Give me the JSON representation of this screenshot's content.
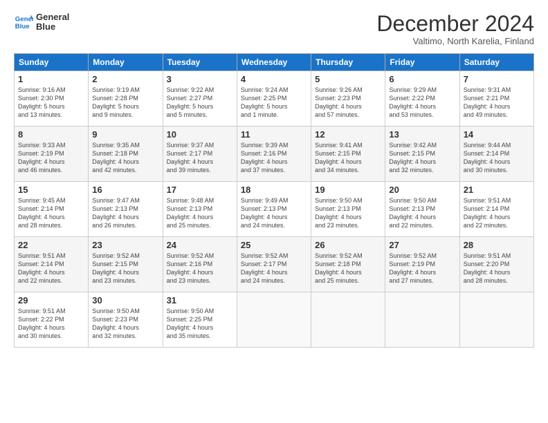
{
  "header": {
    "logo_line1": "General",
    "logo_line2": "Blue",
    "month_title": "December 2024",
    "location": "Valtimo, North Karelia, Finland"
  },
  "days_of_week": [
    "Sunday",
    "Monday",
    "Tuesday",
    "Wednesday",
    "Thursday",
    "Friday",
    "Saturday"
  ],
  "weeks": [
    [
      {
        "day": "1",
        "info": "Sunrise: 9:16 AM\nSunset: 2:30 PM\nDaylight: 5 hours\nand 13 minutes."
      },
      {
        "day": "2",
        "info": "Sunrise: 9:19 AM\nSunset: 2:28 PM\nDaylight: 5 hours\nand 9 minutes."
      },
      {
        "day": "3",
        "info": "Sunrise: 9:22 AM\nSunset: 2:27 PM\nDaylight: 5 hours\nand 5 minutes."
      },
      {
        "day": "4",
        "info": "Sunrise: 9:24 AM\nSunset: 2:25 PM\nDaylight: 5 hours\nand 1 minute."
      },
      {
        "day": "5",
        "info": "Sunrise: 9:26 AM\nSunset: 2:23 PM\nDaylight: 4 hours\nand 57 minutes."
      },
      {
        "day": "6",
        "info": "Sunrise: 9:29 AM\nSunset: 2:22 PM\nDaylight: 4 hours\nand 53 minutes."
      },
      {
        "day": "7",
        "info": "Sunrise: 9:31 AM\nSunset: 2:21 PM\nDaylight: 4 hours\nand 49 minutes."
      }
    ],
    [
      {
        "day": "8",
        "info": "Sunrise: 9:33 AM\nSunset: 2:19 PM\nDaylight: 4 hours\nand 46 minutes."
      },
      {
        "day": "9",
        "info": "Sunrise: 9:35 AM\nSunset: 2:18 PM\nDaylight: 4 hours\nand 42 minutes."
      },
      {
        "day": "10",
        "info": "Sunrise: 9:37 AM\nSunset: 2:17 PM\nDaylight: 4 hours\nand 39 minutes."
      },
      {
        "day": "11",
        "info": "Sunrise: 9:39 AM\nSunset: 2:16 PM\nDaylight: 4 hours\nand 37 minutes."
      },
      {
        "day": "12",
        "info": "Sunrise: 9:41 AM\nSunset: 2:15 PM\nDaylight: 4 hours\nand 34 minutes."
      },
      {
        "day": "13",
        "info": "Sunrise: 9:42 AM\nSunset: 2:15 PM\nDaylight: 4 hours\nand 32 minutes."
      },
      {
        "day": "14",
        "info": "Sunrise: 9:44 AM\nSunset: 2:14 PM\nDaylight: 4 hours\nand 30 minutes."
      }
    ],
    [
      {
        "day": "15",
        "info": "Sunrise: 9:45 AM\nSunset: 2:14 PM\nDaylight: 4 hours\nand 28 minutes."
      },
      {
        "day": "16",
        "info": "Sunrise: 9:47 AM\nSunset: 2:13 PM\nDaylight: 4 hours\nand 26 minutes."
      },
      {
        "day": "17",
        "info": "Sunrise: 9:48 AM\nSunset: 2:13 PM\nDaylight: 4 hours\nand 25 minutes."
      },
      {
        "day": "18",
        "info": "Sunrise: 9:49 AM\nSunset: 2:13 PM\nDaylight: 4 hours\nand 24 minutes."
      },
      {
        "day": "19",
        "info": "Sunrise: 9:50 AM\nSunset: 2:13 PM\nDaylight: 4 hours\nand 23 minutes."
      },
      {
        "day": "20",
        "info": "Sunrise: 9:50 AM\nSunset: 2:13 PM\nDaylight: 4 hours\nand 22 minutes."
      },
      {
        "day": "21",
        "info": "Sunrise: 9:51 AM\nSunset: 2:14 PM\nDaylight: 4 hours\nand 22 minutes."
      }
    ],
    [
      {
        "day": "22",
        "info": "Sunrise: 9:51 AM\nSunset: 2:14 PM\nDaylight: 4 hours\nand 22 minutes."
      },
      {
        "day": "23",
        "info": "Sunrise: 9:52 AM\nSunset: 2:15 PM\nDaylight: 4 hours\nand 23 minutes."
      },
      {
        "day": "24",
        "info": "Sunrise: 9:52 AM\nSunset: 2:16 PM\nDaylight: 4 hours\nand 23 minutes."
      },
      {
        "day": "25",
        "info": "Sunrise: 9:52 AM\nSunset: 2:17 PM\nDaylight: 4 hours\nand 24 minutes."
      },
      {
        "day": "26",
        "info": "Sunrise: 9:52 AM\nSunset: 2:18 PM\nDaylight: 4 hours\nand 25 minutes."
      },
      {
        "day": "27",
        "info": "Sunrise: 9:52 AM\nSunset: 2:19 PM\nDaylight: 4 hours\nand 27 minutes."
      },
      {
        "day": "28",
        "info": "Sunrise: 9:51 AM\nSunset: 2:20 PM\nDaylight: 4 hours\nand 28 minutes."
      }
    ],
    [
      {
        "day": "29",
        "info": "Sunrise: 9:51 AM\nSunset: 2:22 PM\nDaylight: 4 hours\nand 30 minutes."
      },
      {
        "day": "30",
        "info": "Sunrise: 9:50 AM\nSunset: 2:23 PM\nDaylight: 4 hours\nand 32 minutes."
      },
      {
        "day": "31",
        "info": "Sunrise: 9:50 AM\nSunset: 2:25 PM\nDaylight: 4 hours\nand 35 minutes."
      },
      {
        "day": "",
        "info": ""
      },
      {
        "day": "",
        "info": ""
      },
      {
        "day": "",
        "info": ""
      },
      {
        "day": "",
        "info": ""
      }
    ]
  ]
}
